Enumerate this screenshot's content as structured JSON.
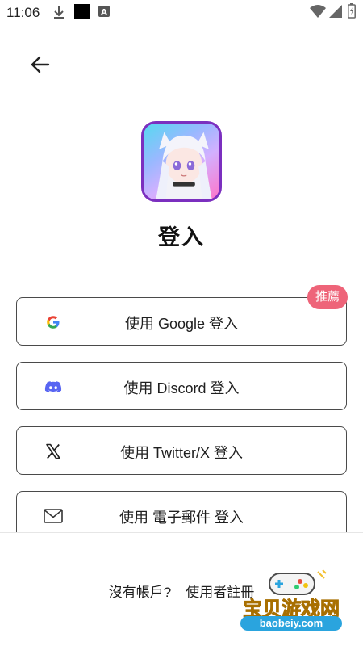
{
  "status_bar": {
    "time": "11:06",
    "left_icons": [
      "download-icon",
      "square-icon",
      "a-icon"
    ],
    "right_icons": [
      "wifi-icon",
      "signal-icon",
      "battery-icon"
    ]
  },
  "header": {
    "back_icon": "arrow-left-icon"
  },
  "page": {
    "title": "登入"
  },
  "login_options": {
    "google": {
      "label": "使用 Google 登入",
      "icon": "google-icon",
      "badge": "推薦"
    },
    "discord": {
      "label": "使用 Discord 登入",
      "icon": "discord-icon"
    },
    "twitter": {
      "label": "使用 Twitter/X 登入",
      "icon": "x-logo-icon"
    },
    "email": {
      "label": "使用 電子郵件 登入",
      "icon": "mail-icon"
    }
  },
  "footer": {
    "prompt": "沒有帳戶?",
    "signup_link": "使用者註冊"
  },
  "watermark": {
    "title": "宝贝游戏网",
    "url": "baobeiy.com"
  },
  "colors": {
    "badge": "#ee6479",
    "discord": "#5865f2",
    "icon_border": "#7b2fbf"
  }
}
